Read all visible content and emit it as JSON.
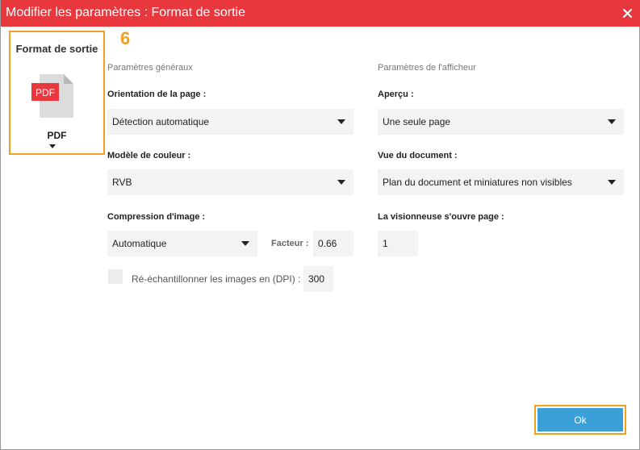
{
  "window": {
    "title": "Modifier les paramètres : Format de sortie",
    "close_icon": "close-icon",
    "accent_color": "#e8383d"
  },
  "format_panel": {
    "title": "Format de sortie",
    "icon": "pdf-file-icon",
    "icon_badge": "PDF",
    "selected_format": "PDF",
    "highlight_color": "#f0a020"
  },
  "step_marker": "6",
  "general": {
    "section_title": "Paramètres généraux",
    "orientation_label": "Orientation de la page :",
    "orientation_value": "Détection automatique",
    "color_model_label": "Modèle de couleur :",
    "color_model_value": "RVB",
    "compression_label": "Compression d'image :",
    "compression_value": "Automatique",
    "factor_label": "Facteur :",
    "factor_value": "0.66",
    "resample_label": "Ré-échantillonner les images en (DPI) :",
    "resample_checked": false,
    "resample_value": "300"
  },
  "viewer": {
    "section_title": "Paramètres de l'afficheur",
    "preview_label": "Aperçu :",
    "preview_value": "Une seule page",
    "document_view_label": "Vue du document :",
    "document_view_value": "Plan du document et miniatures non visibles",
    "open_page_label": "La visionneuse s'ouvre page :",
    "open_page_value": "1"
  },
  "footer": {
    "ok_label": "Ok",
    "ok_color": "#3b9fd8"
  }
}
